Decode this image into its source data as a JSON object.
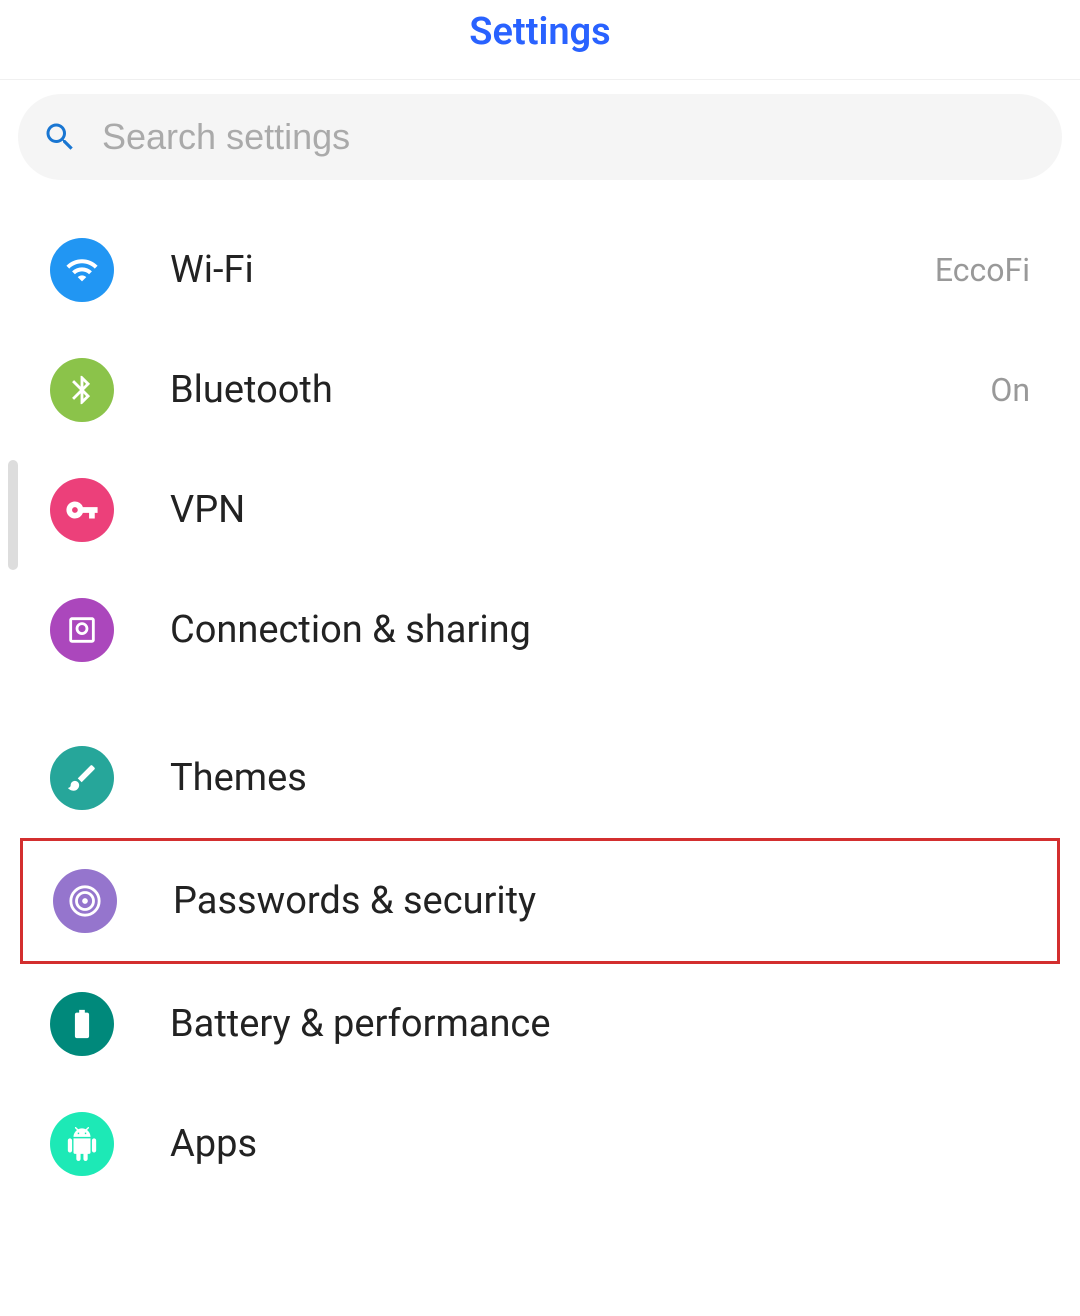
{
  "header": {
    "title": "Settings"
  },
  "search": {
    "placeholder": "Search settings"
  },
  "items": [
    {
      "label": "Wi-Fi",
      "value": "EccoFi",
      "icon": "wifi",
      "color": "bg-blue"
    },
    {
      "label": "Bluetooth",
      "value": "On",
      "icon": "bluetooth",
      "color": "bg-green"
    },
    {
      "label": "VPN",
      "value": "",
      "icon": "vpn",
      "color": "bg-pink"
    },
    {
      "label": "Connection & sharing",
      "value": "",
      "icon": "connection",
      "color": "bg-purple"
    },
    {
      "label": "Themes",
      "value": "",
      "icon": "themes",
      "color": "bg-teal"
    },
    {
      "label": "Passwords & security",
      "value": "",
      "icon": "security",
      "color": "bg-violet",
      "highlighted": true
    },
    {
      "label": "Battery & performance",
      "value": "",
      "icon": "battery",
      "color": "bg-teal2"
    },
    {
      "label": "Apps",
      "value": "",
      "icon": "apps",
      "color": "bg-teal3"
    }
  ]
}
